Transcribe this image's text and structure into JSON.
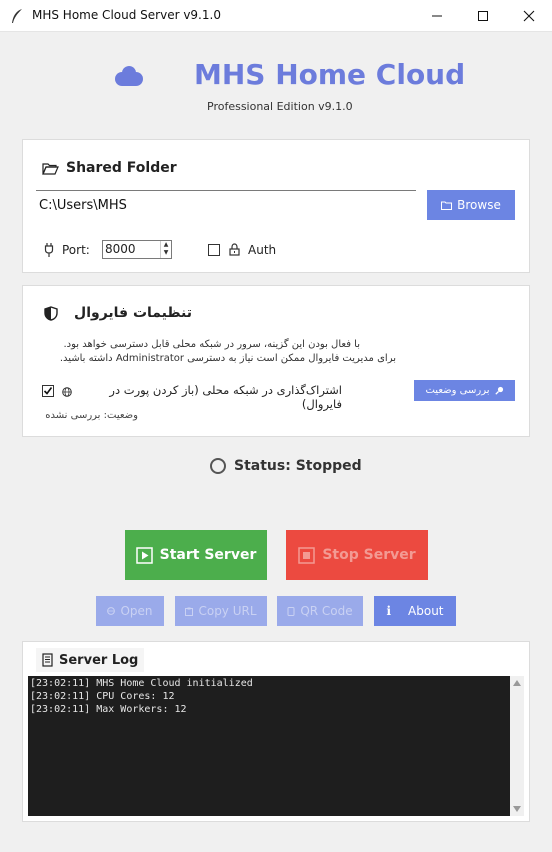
{
  "window": {
    "title": "MHS Home Cloud Server v9.1.0",
    "controls": [
      "minimize-icon",
      "maximize-icon",
      "close-icon"
    ]
  },
  "header": {
    "logo_icon": "cloud-icon",
    "title": "MHS Home Cloud",
    "subtitle": "Professional Edition v9.1.0",
    "accent_color": "#6c7cdc"
  },
  "shared_folder": {
    "title": "Shared Folder",
    "icon": "folder-open-icon",
    "path_value": "C:\\Users\\MHS",
    "browse_label": "Browse",
    "port_label": "Port:",
    "port_value": "8000",
    "auth_label": "Auth",
    "auth_checked": false
  },
  "firewall": {
    "title": "تنظیمات فایروال",
    "icon": "shield-icon",
    "desc_line1": "با فعال بودن این گزینه، سرور در شبکه محلی قابل دسترسی خواهد بود.",
    "desc_line2": "برای مدیریت فایروال ممکن است نیاز به دسترسی Administrator داشته باشید.",
    "share_label": "اشتراک‌گذاری در شبکه محلی (باز کردن پورت در فایروال)",
    "share_checked": true,
    "check_button": "بررسی وضعیت",
    "status_text": "وضعیت: بررسی نشده"
  },
  "status": {
    "text": "Status: Stopped"
  },
  "actions": {
    "start_label": "Start Server",
    "stop_label": "Stop Server",
    "start_color": "#4cae4c",
    "stop_color": "#ec4a40",
    "open_label": "Open",
    "copy_url_label": "Copy URL",
    "qr_label": "QR Code",
    "about_label": "About"
  },
  "log": {
    "title": "Server Log",
    "lines": [
      "[23:02:11] MHS Home Cloud initialized",
      "[23:02:11] CPU Cores: 12",
      "[23:02:11] Max Workers: 12"
    ]
  }
}
